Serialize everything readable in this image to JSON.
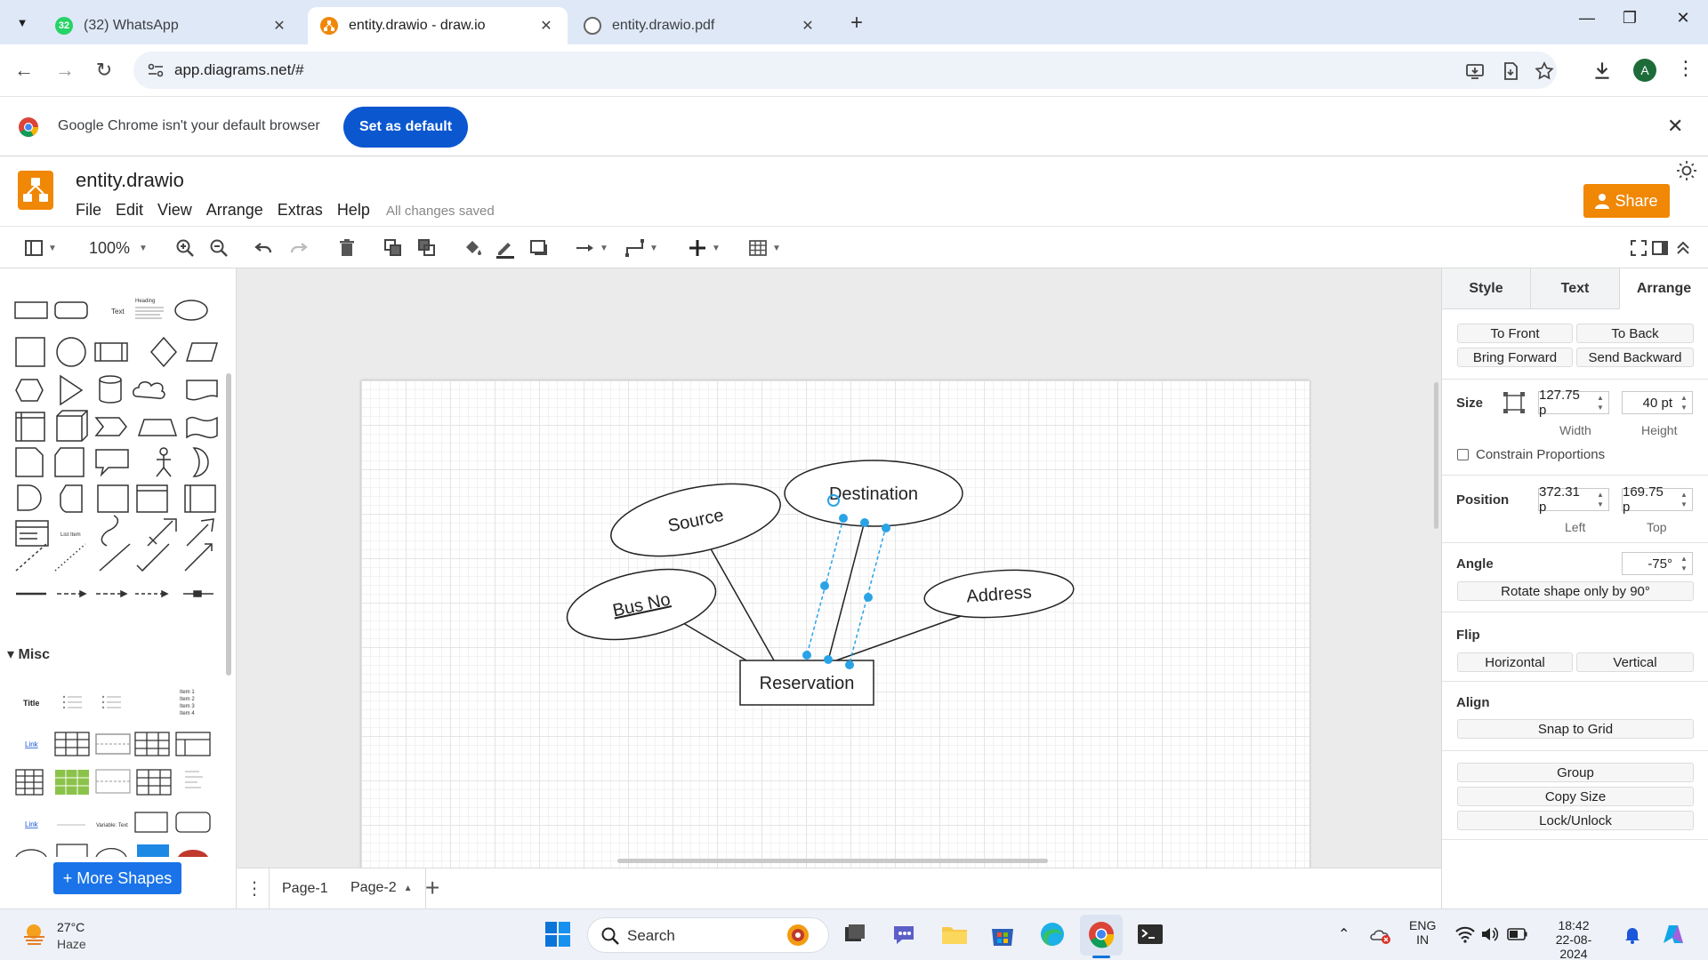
{
  "browser": {
    "tabs": [
      {
        "title": "(32) WhatsApp",
        "badge": "32",
        "active": false
      },
      {
        "title": "entity.drawio - draw.io",
        "active": true
      },
      {
        "title": "entity.drawio.pdf",
        "active": false
      }
    ],
    "url": "app.diagrams.net/#",
    "profile_initial": "A",
    "infobar": {
      "message": "Google Chrome isn't your default browser",
      "button": "Set as default"
    }
  },
  "app": {
    "file_title": "entity.drawio",
    "menu": [
      "File",
      "Edit",
      "View",
      "Arrange",
      "Extras",
      "Help"
    ],
    "save_status": "All changes saved",
    "share_label": "Share",
    "zoom": "100%",
    "accent": "#f08705"
  },
  "left_panel": {
    "section": "Misc",
    "more_shapes": "+ More Shapes",
    "thumb_labels": {
      "text": "Text",
      "heading": "Heading",
      "list_item": "List Item",
      "title": "Title",
      "link": "Link",
      "variable": "Variable: Text",
      "items": [
        "Item 1",
        "Item 2",
        "Item 3",
        "Item 4"
      ]
    }
  },
  "diagram": {
    "entity": "Reservation",
    "attributes": [
      "Source",
      "Destination",
      "Bus No",
      "Address"
    ],
    "key_attribute": "Bus No",
    "selection_color": "#29a3e6"
  },
  "pages": {
    "tabs": [
      "Page-1",
      "Page-2"
    ],
    "active": "Page-2"
  },
  "format_panel": {
    "tabs": [
      "Style",
      "Text",
      "Arrange"
    ],
    "active_tab": "Arrange",
    "order_buttons": [
      "To Front",
      "To Back",
      "Bring Forward",
      "Send Backward"
    ],
    "size": {
      "label": "Size",
      "width": "127.75 p",
      "height": "40 pt",
      "width_label": "Width",
      "height_label": "Height"
    },
    "constrain": "Constrain Proportions",
    "position": {
      "label": "Position",
      "left": "372.31 p",
      "top": "169.75 p",
      "left_label": "Left",
      "top_label": "Top"
    },
    "angle": {
      "label": "Angle",
      "value": "-75°",
      "rotate_button": "Rotate shape only by 90°"
    },
    "flip": {
      "label": "Flip",
      "horizontal": "Horizontal",
      "vertical": "Vertical"
    },
    "align": {
      "label": "Align",
      "snap": "Snap to Grid"
    },
    "group": "Group",
    "copy_size": "Copy Size",
    "lock": "Lock/Unlock"
  },
  "taskbar": {
    "temp": "27°C",
    "condition": "Haze",
    "search": "Search",
    "lang": "ENG",
    "region": "IN",
    "time": "18:42",
    "date": "22-08-2024"
  }
}
